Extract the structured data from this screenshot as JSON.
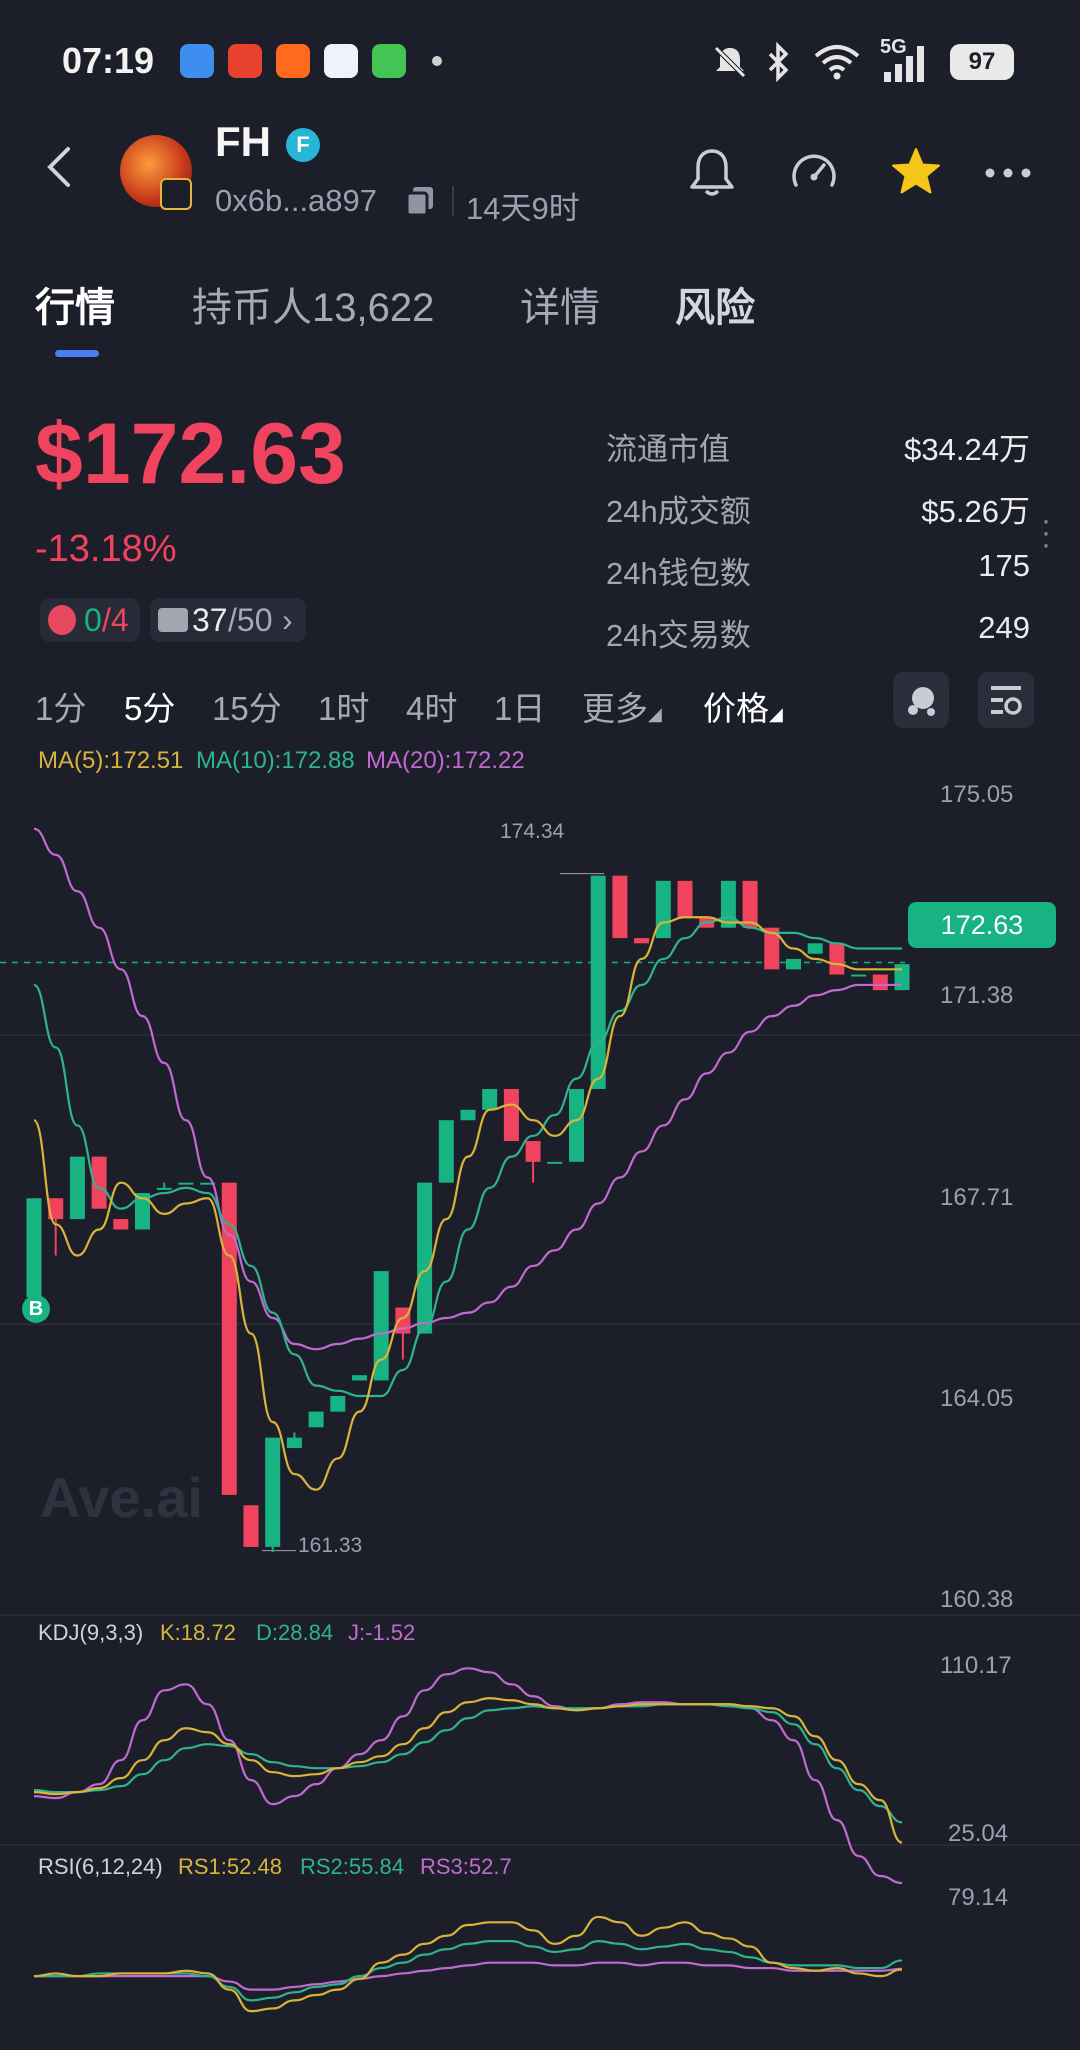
{
  "status_bar": {
    "time": "07:19",
    "network": "5G",
    "battery": "97"
  },
  "header": {
    "token_name": "FH",
    "verified_badge": "F",
    "address": "0x6b...a897",
    "age": "14天9时"
  },
  "tabs": [
    {
      "label": "行情"
    },
    {
      "label": "持币人13,622"
    },
    {
      "label": "详情"
    },
    {
      "label": "风险"
    }
  ],
  "price": {
    "value": "$172.63",
    "change": "-13.18%"
  },
  "badges": {
    "bag": {
      "num": "0",
      "den": "/4"
    },
    "top": {
      "num": "37",
      "den": "/50"
    }
  },
  "stats": [
    {
      "label": "流通市值",
      "value": "$34.24万"
    },
    {
      "label": "24h成交额",
      "value": "$5.26万"
    },
    {
      "label": "24h钱包数",
      "value": "175"
    },
    {
      "label": "24h交易数",
      "value": "249"
    }
  ],
  "timeframes": [
    "1分",
    "5分",
    "15分",
    "1时",
    "4时",
    "1日",
    "更多"
  ],
  "active_timeframe": "5分",
  "price_dropdown": "价格",
  "colors": {
    "up": "#17b383",
    "down": "#f0435e",
    "ma5": "#d9b43a",
    "ma10": "#2fb38f",
    "ma20": "#c26ad1",
    "accent": "#4b7cf2"
  },
  "chart_data": {
    "type": "candlestick",
    "ma_legend": {
      "ma5": "MA(5):172.51",
      "ma10": "MA(10):172.88",
      "ma20": "MA(20):172.22"
    },
    "y_ticks": [
      "175.05",
      "171.38",
      "167.71",
      "164.05",
      "160.38"
    ],
    "ylim": [
      160.38,
      175.85
    ],
    "last_price": "172.63",
    "high_label": "174.34",
    "low_label": "161.33",
    "buy_marker": "B",
    "watermark": "Ave.ai",
    "candles": [
      {
        "o": 166.2,
        "c": 168.1,
        "h": 168.1,
        "l": 166.2
      },
      {
        "o": 168.1,
        "c": 167.7,
        "h": 168.1,
        "l": 167.0
      },
      {
        "o": 167.7,
        "c": 168.9,
        "h": 168.9,
        "l": 167.7
      },
      {
        "o": 168.9,
        "c": 167.9,
        "h": 168.9,
        "l": 167.9
      },
      {
        "o": 167.7,
        "c": 167.5,
        "h": 167.7,
        "l": 167.5
      },
      {
        "o": 167.5,
        "c": 168.2,
        "h": 168.2,
        "l": 167.5
      },
      {
        "o": 168.3,
        "c": 168.3,
        "h": 168.4,
        "l": 168.3
      },
      {
        "o": 168.4,
        "c": 168.4,
        "h": 168.4,
        "l": 168.4
      },
      {
        "o": 168.4,
        "c": 168.4,
        "h": 168.4,
        "l": 168.4
      },
      {
        "o": 168.4,
        "c": 162.4,
        "h": 168.4,
        "l": 162.4
      },
      {
        "o": 162.2,
        "c": 161.4,
        "h": 162.2,
        "l": 161.4
      },
      {
        "o": 161.4,
        "c": 163.5,
        "h": 163.5,
        "l": 161.3
      },
      {
        "o": 163.3,
        "c": 163.5,
        "h": 163.6,
        "l": 163.3
      },
      {
        "o": 163.7,
        "c": 164.0,
        "h": 164.0,
        "l": 163.7
      },
      {
        "o": 164.0,
        "c": 164.3,
        "h": 164.3,
        "l": 164.0
      },
      {
        "o": 164.6,
        "c": 164.7,
        "h": 164.7,
        "l": 164.6
      },
      {
        "o": 164.6,
        "c": 166.7,
        "h": 166.7,
        "l": 164.6
      },
      {
        "o": 166.0,
        "c": 165.5,
        "h": 166.0,
        "l": 165.0
      },
      {
        "o": 165.5,
        "c": 168.4,
        "h": 168.4,
        "l": 165.5
      },
      {
        "o": 168.4,
        "c": 169.6,
        "h": 169.6,
        "l": 168.4
      },
      {
        "o": 169.6,
        "c": 169.8,
        "h": 169.8,
        "l": 169.6
      },
      {
        "o": 169.8,
        "c": 170.2,
        "h": 170.2,
        "l": 169.8
      },
      {
        "o": 170.2,
        "c": 169.2,
        "h": 170.2,
        "l": 169.2
      },
      {
        "o": 169.2,
        "c": 168.8,
        "h": 169.2,
        "l": 168.4
      },
      {
        "o": 168.8,
        "c": 168.8,
        "h": 168.8,
        "l": 168.8
      },
      {
        "o": 168.8,
        "c": 170.2,
        "h": 170.2,
        "l": 168.8
      },
      {
        "o": 170.2,
        "c": 174.3,
        "h": 174.3,
        "l": 170.2
      },
      {
        "o": 174.3,
        "c": 173.1,
        "h": 174.3,
        "l": 173.1
      },
      {
        "o": 173.1,
        "c": 173.0,
        "h": 173.1,
        "l": 173.0
      },
      {
        "o": 173.1,
        "c": 174.2,
        "h": 174.2,
        "l": 173.1
      },
      {
        "o": 174.2,
        "c": 173.5,
        "h": 174.2,
        "l": 173.5
      },
      {
        "o": 173.5,
        "c": 173.3,
        "h": 173.5,
        "l": 173.3
      },
      {
        "o": 173.3,
        "c": 174.2,
        "h": 174.2,
        "l": 173.3
      },
      {
        "o": 174.2,
        "c": 173.3,
        "h": 174.2,
        "l": 173.3
      },
      {
        "o": 173.3,
        "c": 172.5,
        "h": 173.3,
        "l": 172.5
      },
      {
        "o": 172.5,
        "c": 172.7,
        "h": 172.7,
        "l": 172.5
      },
      {
        "o": 172.8,
        "c": 173.0,
        "h": 173.0,
        "l": 172.8
      },
      {
        "o": 173.0,
        "c": 172.4,
        "h": 173.0,
        "l": 172.4
      },
      {
        "o": 172.4,
        "c": 172.4,
        "h": 172.4,
        "l": 172.4
      },
      {
        "o": 172.4,
        "c": 172.1,
        "h": 172.4,
        "l": 172.1
      },
      {
        "o": 172.1,
        "c": 172.6,
        "h": 172.6,
        "l": 172.1
      }
    ],
    "ma5": [
      169.6,
      167.6,
      167.0,
      167.5,
      168.4,
      168.1,
      167.8,
      168.0,
      168.1,
      167.0,
      165.5,
      163.8,
      162.8,
      162.5,
      163.1,
      164.0,
      165.0,
      165.8,
      166.7,
      167.7,
      168.9,
      169.8,
      169.9,
      169.6,
      169.3,
      169.6,
      170.4,
      171.6,
      172.7,
      173.4,
      173.5,
      173.5,
      173.4,
      173.4,
      173.2,
      172.9,
      172.7,
      172.6,
      172.5,
      172.5,
      172.5
    ],
    "ma10": [
      172.2,
      171.0,
      169.5,
      168.3,
      167.9,
      168.1,
      168.2,
      168.3,
      168.2,
      167.6,
      166.8,
      165.9,
      165.1,
      164.5,
      164.4,
      164.3,
      164.3,
      164.8,
      165.6,
      166.5,
      167.5,
      168.3,
      168.9,
      169.3,
      169.7,
      170.4,
      171.1,
      171.7,
      172.2,
      172.7,
      173.1,
      173.4,
      173.5,
      173.3,
      173.2,
      173.2,
      173.1,
      173.0,
      172.9,
      172.9,
      172.9
    ],
    "ma20": [
      175.2,
      174.7,
      174.0,
      173.3,
      172.5,
      171.6,
      170.7,
      169.6,
      168.5,
      167.4,
      166.5,
      165.8,
      165.3,
      165.2,
      165.3,
      165.4,
      165.5,
      165.6,
      165.7,
      165.8,
      165.9,
      166.1,
      166.4,
      166.8,
      167.1,
      167.5,
      168.0,
      168.5,
      169.0,
      169.5,
      170.0,
      170.5,
      170.9,
      171.3,
      171.6,
      171.8,
      172.0,
      172.1,
      172.2,
      172.2,
      172.2
    ]
  },
  "kdj": {
    "legend": {
      "title": "KDJ(9,3,3)",
      "k": "K:18.72",
      "d": "D:28.84",
      "j": "J:-1.52"
    },
    "y_ticks": [
      "110.17",
      "25.04"
    ],
    "ylim": [
      25.04,
      110.17
    ],
    "k": [
      44,
      43,
      44,
      46,
      51,
      60,
      70,
      76,
      74,
      68,
      60,
      54,
      52,
      53,
      56,
      59,
      62,
      68,
      76,
      84,
      89,
      91,
      90,
      88,
      86,
      85,
      86,
      87,
      88,
      88,
      88,
      88,
      88,
      87,
      86,
      82,
      72,
      60,
      48,
      40,
      18.72
    ],
    "d": [
      45,
      44,
      44,
      45,
      47,
      53,
      60,
      66,
      68,
      67,
      63,
      59,
      57,
      56,
      56,
      57,
      59,
      63,
      69,
      75,
      81,
      85,
      86,
      87,
      86,
      86,
      86,
      87,
      87,
      88,
      88,
      88,
      87,
      86,
      84,
      78,
      68,
      56,
      45,
      37,
      28.84
    ],
    "j": [
      42,
      41,
      44,
      48,
      60,
      80,
      95,
      98,
      88,
      70,
      50,
      38,
      42,
      48,
      56,
      63,
      70,
      82,
      95,
      103,
      106,
      104,
      98,
      92,
      87,
      85,
      86,
      88,
      89,
      89,
      88,
      88,
      88,
      86,
      80,
      70,
      50,
      30,
      12,
      2,
      -1.52
    ]
  },
  "rsi": {
    "legend": {
      "title": "RSI(6,12,24)",
      "rs1": "RS1:52.48",
      "rs2": "RS2:55.84",
      "rs3": "RS3:52.7"
    },
    "y_ticks": [
      "79.14"
    ],
    "ylim": [
      30,
      82
    ],
    "rs1": [
      50,
      51,
      50,
      50,
      51,
      51,
      51,
      52,
      51,
      45,
      37,
      38,
      41,
      43,
      45,
      49,
      55,
      58,
      62,
      65,
      69,
      70,
      70,
      67,
      62,
      65,
      72,
      70,
      65,
      68,
      70,
      66,
      64,
      61,
      55,
      53,
      52,
      53,
      51,
      50,
      52.48
    ],
    "rs2": [
      50,
      50,
      50,
      51,
      51,
      51,
      51,
      51,
      50,
      46,
      41,
      42,
      44,
      46,
      47,
      50,
      53,
      55,
      58,
      60,
      62,
      63,
      63,
      61,
      59,
      60,
      63,
      62,
      60,
      61,
      62,
      60,
      59,
      57,
      55,
      54,
      54,
      54,
      53,
      53,
      55.84
    ],
    "rs3": [
      50,
      50,
      50,
      50,
      50,
      50,
      50,
      50,
      50,
      48,
      45,
      45,
      46,
      47,
      48,
      49,
      50,
      51,
      52,
      53,
      54,
      55,
      55,
      55,
      54,
      54,
      55,
      55,
      54,
      55,
      55,
      54,
      54,
      53,
      53,
      52,
      52,
      52,
      52,
      52,
      52.7
    ]
  }
}
